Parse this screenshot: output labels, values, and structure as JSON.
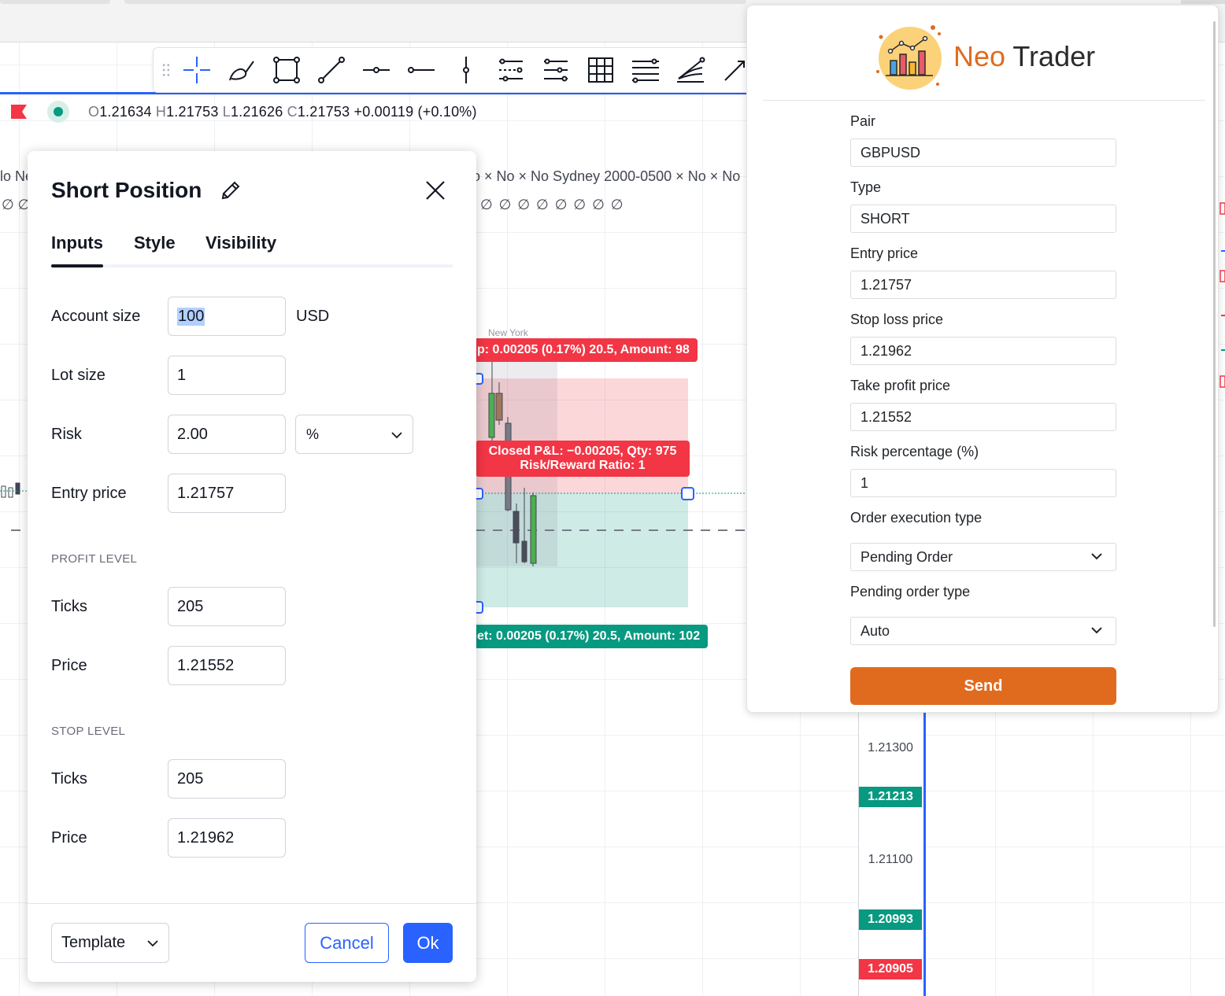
{
  "ohlc": {
    "o_key": "O",
    "o_val": "1.21634",
    "h_key": "H",
    "h_val": "1.21753",
    "l_key": "L",
    "l_val": "1.21626",
    "c_key": "C",
    "c_val": "1.21753",
    "change": "+0.00119 (+0.10%)"
  },
  "session": {
    "right_text": "o × No × No Sydney 2000-0500 × No × No",
    "left_text": "lo Ne",
    "nosym_right": "∅∅∅∅∅∅∅∅",
    "nosym_left": "∅ ∅",
    "new_york": "New York"
  },
  "position_tool": {
    "stop_label": "p: 0.00205 (0.17%) 20.5, Amount: 98",
    "pnl_line1": "Closed P&L: −0.00205, Qty: 975",
    "pnl_line2": "Risk/Reward Ratio: 1",
    "target_label": "et: 0.00205 (0.17%) 20.5, Amount: 102"
  },
  "price_axis": {
    "p1": "1.21300",
    "p2": "1.21213",
    "p3": "1.21100",
    "p4": "1.20993",
    "p5": "1.20905"
  },
  "dialog": {
    "title": "Short Position",
    "tabs": [
      "Inputs",
      "Style",
      "Visibility"
    ],
    "account_size_label": "Account size",
    "account_size_value": "100",
    "account_size_unit": "USD",
    "lot_size_label": "Lot size",
    "lot_size_value": "1",
    "risk_label": "Risk",
    "risk_value": "2.00",
    "risk_unit": "%",
    "entry_price_label": "Entry price",
    "entry_price_value": "1.21757",
    "profit_level_title": "PROFIT LEVEL",
    "profit_ticks_label": "Ticks",
    "profit_ticks_value": "205",
    "profit_price_label": "Price",
    "profit_price_value": "1.21552",
    "stop_level_title": "STOP LEVEL",
    "stop_ticks_label": "Ticks",
    "stop_ticks_value": "205",
    "stop_price_label": "Price",
    "stop_price_value": "1.21962",
    "template_label": "Template",
    "cancel_label": "Cancel",
    "ok_label": "Ok"
  },
  "neo": {
    "brand_first": "Neo",
    "brand_second": "Trader",
    "pair_label": "Pair",
    "pair_value": "GBPUSD",
    "type_label": "Type",
    "type_value": "SHORT",
    "entry_label": "Entry price",
    "entry_value": "1.21757",
    "sl_label": "Stop loss price",
    "sl_value": "1.21962",
    "tp_label": "Take profit price",
    "tp_value": "1.21552",
    "risk_label": "Risk percentage (%)",
    "risk_value": "1",
    "exec_label": "Order execution type",
    "exec_value": "Pending Order",
    "pending_label": "Pending order type",
    "pending_value": "Auto",
    "send_label": "Send",
    "accent_color": "#e06b1f"
  },
  "colors": {
    "tv_blue": "#2962ff",
    "up_green": "#089981",
    "down_red": "#f23645"
  },
  "icons": {
    "toolbar": [
      "drag-handle-icon",
      "crosshair-icon",
      "brush-icon",
      "rectangle-icon",
      "trend-line-icon",
      "horizontal-ray-icon",
      "horizontal-line-icon",
      "vertical-line-icon",
      "parallel-channel-icon",
      "regression-trend-icon",
      "gann-box-icon",
      "fib-retracement-icon",
      "fib-fan-icon",
      "arrow-icon"
    ]
  }
}
